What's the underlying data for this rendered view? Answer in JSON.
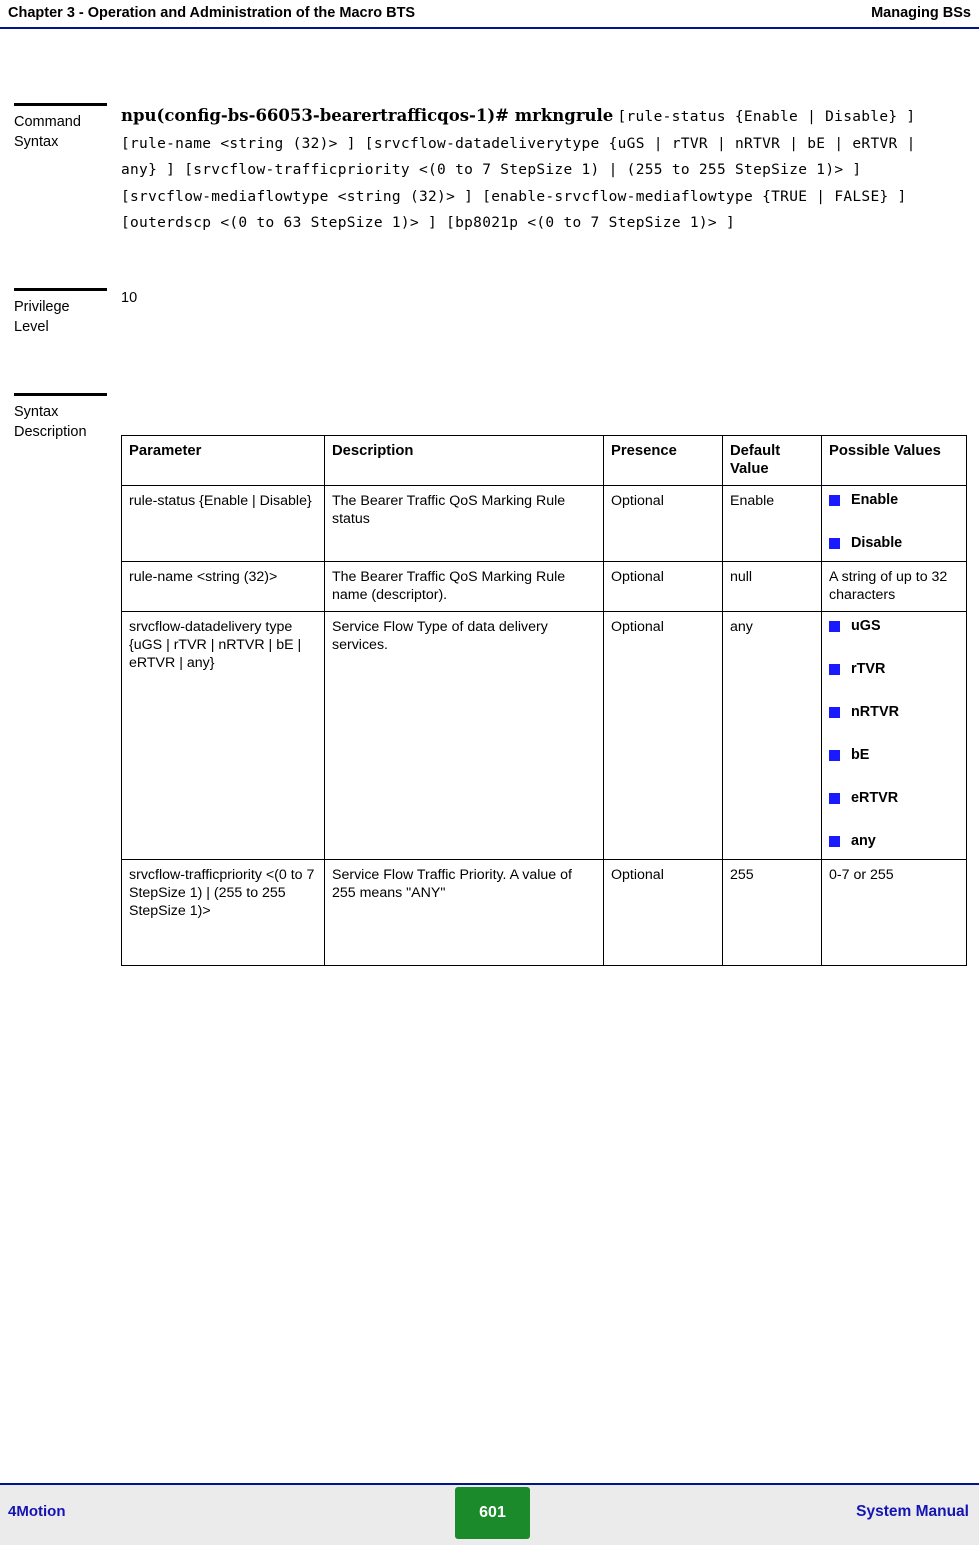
{
  "header": {
    "left": "Chapter 3 - Operation and Administration of the Macro BTS",
    "right": "Managing BSs"
  },
  "sections": {
    "command_syntax": {
      "label_line1": "Command",
      "label_line2": "Syntax",
      "prompt": "npu(config-bs-66053-bearertrafficqos-1)# mrkngrule",
      "args": "[rule-status {Enable | Disable} ] [rule-name <string (32)> ] [srvcflow-datadeliverytype {uGS | rTVR | nRTVR | bE | eRTVR | any} ] [srvcflow-trafficpriority <(0 to 7 StepSize 1) | (255 to 255 StepSize 1)> ] [srvcflow-mediaflowtype <string (32)> ] [enable-srvcflow-mediaflowtype {TRUE | FALSE} ] [outerdscp <(0 to 63 StepSize 1)> ] [bp8021p <(0 to 7 StepSize 1)> ]"
    },
    "privilege_level": {
      "label_line1": "Privilege",
      "label_line2": "Level",
      "value": "10"
    },
    "syntax_description": {
      "label_line1": "Syntax",
      "label_line2": "Description"
    }
  },
  "table": {
    "headers": [
      "Parameter",
      "Description",
      "Presence",
      "Default Value",
      "Possible Values"
    ],
    "rows": [
      {
        "parameter": "rule-status {Enable | Disable}",
        "description": "The Bearer Traffic QoS Marking Rule status",
        "presence": "Optional",
        "default": "Enable",
        "possible_values": [
          "Enable",
          "Disable"
        ],
        "possible_text": null
      },
      {
        "parameter": "rule-name <string (32)>",
        "description": "The Bearer Traffic QoS Marking Rule name (descriptor).",
        "presence": "Optional",
        "default": "null",
        "possible_values": null,
        "possible_text": "A string of up to 32 characters"
      },
      {
        "parameter": "srvcflow-datadelivery type {uGS | rTVR | nRTVR | bE | eRTVR | any}",
        "description": "Service Flow Type of data delivery services.",
        "presence": "Optional",
        "default": "any",
        "possible_values": [
          "uGS",
          "rTVR",
          "nRTVR",
          "bE",
          "eRTVR",
          "any"
        ],
        "possible_text": null
      },
      {
        "parameter": "srvcflow-trafficpriority <(0 to 7 StepSize 1) | (255 to 255 StepSize 1)>",
        "description": "Service Flow Traffic Priority. A value of 255 means \"ANY\"",
        "presence": "Optional",
        "default": "255",
        "possible_values": null,
        "possible_text": "0-7 or 255"
      }
    ]
  },
  "footer": {
    "left": "4Motion",
    "page": "601",
    "right": "System Manual"
  },
  "colors": {
    "rule": "#00148c",
    "bullet": "#1a1aff",
    "footer_text": "#1414b4",
    "page_badge": "#1b8a2a"
  }
}
